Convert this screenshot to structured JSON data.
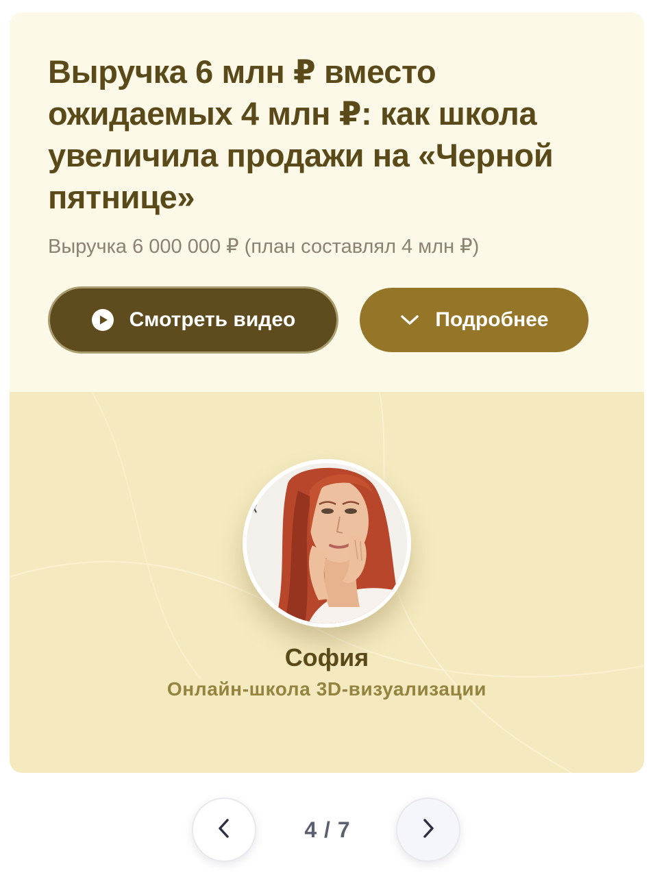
{
  "case": {
    "title": "Выручка 6 млн ₽ вместо ожидаемых 4 млн ₽: как школа увеличила продажи на «Черной пятнице»",
    "subtitle": "Выручка 6 000 000 ₽ (план составлял 4 млн ₽)",
    "buttons": {
      "video_label": "Смотреть видео",
      "video_icon": "play-circle-icon",
      "more_label": "Подробнее",
      "more_icon": "chevron-down-icon"
    },
    "person": {
      "name": "София",
      "school": "Онлайн-школа 3D-визуализации"
    }
  },
  "pager": {
    "current": "4",
    "separator": " / ",
    "total": "7",
    "prev_icon": "chevron-left-icon",
    "next_icon": "chevron-right-icon"
  },
  "colors": {
    "title": "#5a4a1a",
    "card_top": "#fdf9e8",
    "card_bottom": "#f5eabf",
    "button_dark": "#5e4c1e",
    "button_gold": "#957629"
  }
}
